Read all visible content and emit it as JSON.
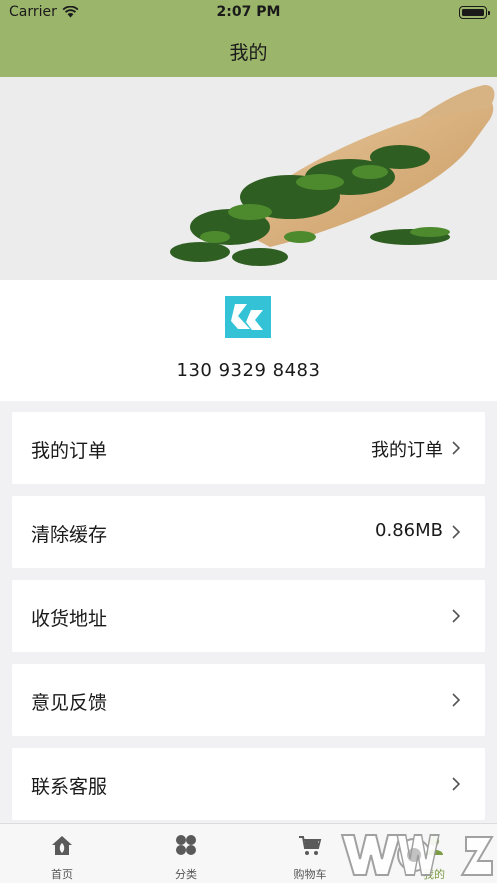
{
  "status_bar": {
    "carrier": "Carrier",
    "time": "2:07 PM"
  },
  "header": {
    "title": "我的"
  },
  "profile": {
    "phone": "130 9329 8483"
  },
  "menu": {
    "items": [
      {
        "label": "我的订单",
        "value": "我的订单"
      },
      {
        "label": "清除缓存",
        "value": "0.86MB"
      },
      {
        "label": "收货地址",
        "value": ""
      },
      {
        "label": "意见反馈",
        "value": ""
      },
      {
        "label": "联系客服",
        "value": ""
      }
    ]
  },
  "tabbar": {
    "tabs": [
      {
        "label": "首页",
        "icon": "home-icon"
      },
      {
        "label": "分类",
        "icon": "category-icon"
      },
      {
        "label": "购物车",
        "icon": "cart-icon"
      },
      {
        "label": "我的",
        "icon": "profile-icon"
      }
    ],
    "active": "我的"
  },
  "colors": {
    "header": "#9bb56b",
    "accent": "#7c9b45",
    "logo": "#33c2d6"
  }
}
